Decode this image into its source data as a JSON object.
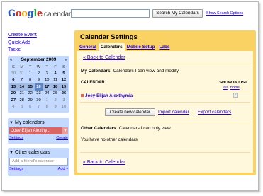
{
  "header": {
    "logo_letters": [
      "G",
      "o",
      "o",
      "g",
      "l",
      "e"
    ],
    "logo_colors": [
      "#2a5db0",
      "#d62d20",
      "#e8a317",
      "#2a5db0",
      "#28a745",
      "#d62d20"
    ],
    "product": "calendar",
    "search_button": "Search My Calendars",
    "search_options": "Show Search Options"
  },
  "left": {
    "links": [
      "Create Event",
      "Quick Add",
      "Tasks"
    ],
    "mini_calendar": {
      "month": "September 2009",
      "prev": "«",
      "next": "»",
      "weekdays": [
        "S",
        "M",
        "T",
        "W",
        "T",
        "F",
        "S"
      ],
      "weeks": [
        [
          [
            "30",
            1
          ],
          [
            "31",
            1
          ],
          [
            "1",
            0
          ],
          [
            "2",
            0
          ],
          [
            "3",
            0
          ],
          [
            "4",
            0
          ],
          [
            "5",
            0
          ]
        ],
        [
          [
            "6",
            0
          ],
          [
            "7",
            0
          ],
          [
            "8",
            0
          ],
          [
            "9",
            0
          ],
          [
            "10",
            0
          ],
          [
            "11",
            0
          ],
          [
            "12",
            0
          ]
        ],
        [
          [
            "13",
            0
          ],
          [
            "14",
            0
          ],
          [
            "15",
            0
          ],
          [
            "16",
            0
          ],
          [
            "17",
            0
          ],
          [
            "18",
            0
          ],
          [
            "19",
            0
          ]
        ],
        [
          [
            "20",
            0
          ],
          [
            "21",
            0
          ],
          [
            "22",
            0
          ],
          [
            "23",
            0
          ],
          [
            "24",
            0
          ],
          [
            "25",
            0
          ],
          [
            "26",
            0
          ]
        ],
        [
          [
            "27",
            0
          ],
          [
            "28",
            0
          ],
          [
            "29",
            0
          ],
          [
            "30",
            0
          ],
          [
            "1",
            1
          ],
          [
            "2",
            1
          ],
          [
            "3",
            1
          ]
        ],
        [
          [
            "4",
            1
          ],
          [
            "5",
            1
          ],
          [
            "6",
            1
          ],
          [
            "7",
            1
          ],
          [
            "8",
            1
          ],
          [
            "9",
            1
          ],
          [
            "10",
            1
          ]
        ]
      ]
    },
    "my_calendars": {
      "title": "My calendars",
      "item": "Joev-Elijah Alexthy...",
      "item_color": "#d96666",
      "settings": "Settings",
      "create": "Create"
    },
    "other_calendars": {
      "title": "Other calendars",
      "placeholder": "Add a friend's calendar",
      "settings": "Settings",
      "add": "Add"
    }
  },
  "settings": {
    "title": "Calendar Settings",
    "tabs": [
      "General",
      "Calendars",
      "Mobile Setup",
      "Labs"
    ],
    "back": "« Back to Calendar",
    "my_calendars_title": "My Calendars",
    "my_calendars_desc": "Calendars I can view and modify",
    "calendar_header": "CALENDAR",
    "show_in_list": "SHOW IN LIST",
    "all": "all",
    "none": "none",
    "calendar_name": "Joey-Elijah Alexthymia",
    "create_button": "Create new calendar",
    "import": "Import calendar",
    "export": "Export calendars",
    "other_title": "Other Calendars",
    "other_desc": "Calendars I can only view",
    "no_other": "You have no other calendars",
    "back_bottom": "« Back to Calendar"
  },
  "colors": {
    "blue_panel": "#c3d9ff",
    "settings_bg": "#fad163",
    "settings_inner": "#fff8dc",
    "link": "#2200cc"
  }
}
